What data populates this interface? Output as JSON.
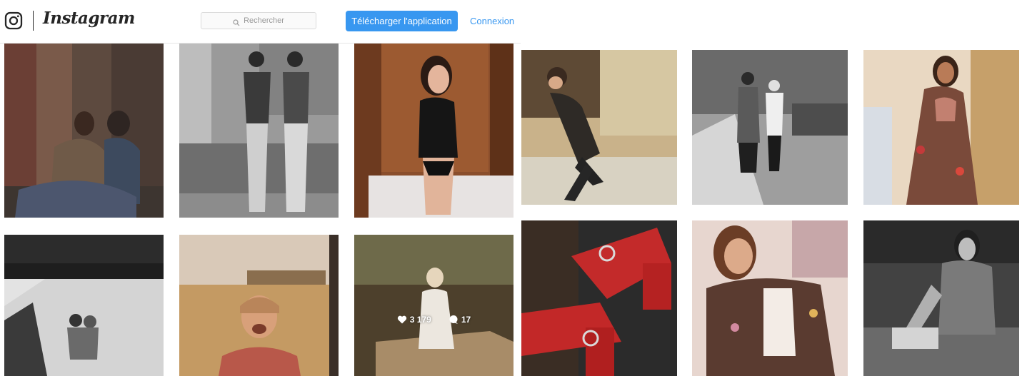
{
  "header": {
    "brand": "Instagram",
    "search_placeholder": "Rechercher",
    "download_button": "Télécharger l'application",
    "login_link": "Connexion"
  },
  "posts": [
    {
      "id": "post-1",
      "subject": "couple-embrace",
      "tone": "color"
    },
    {
      "id": "post-2",
      "subject": "two-men-standing",
      "tone": "bw"
    },
    {
      "id": "post-3",
      "subject": "woman-laughing",
      "tone": "color"
    },
    {
      "id": "post-4",
      "subject": "man-walking-street",
      "tone": "color"
    },
    {
      "id": "post-5",
      "subject": "couple-walking-street",
      "tone": "bw"
    },
    {
      "id": "post-6",
      "subject": "woman-floral-jacket",
      "tone": "color"
    },
    {
      "id": "post-7",
      "subject": "couple-car",
      "tone": "bw"
    },
    {
      "id": "post-8",
      "subject": "man-laughing-field",
      "tone": "color"
    },
    {
      "id": "post-9",
      "subject": "woman-on-car",
      "tone": "color",
      "likes": "3 179",
      "comments": "17"
    },
    {
      "id": "post-10",
      "subject": "red-studded-sandals",
      "tone": "color"
    },
    {
      "id": "post-11",
      "subject": "woman-floral-outfit",
      "tone": "color"
    },
    {
      "id": "post-12",
      "subject": "tattooed-man-car",
      "tone": "bw"
    }
  ],
  "colors": {
    "accent": "#3897f0",
    "text": "#262626",
    "border": "#dbdbdb"
  }
}
